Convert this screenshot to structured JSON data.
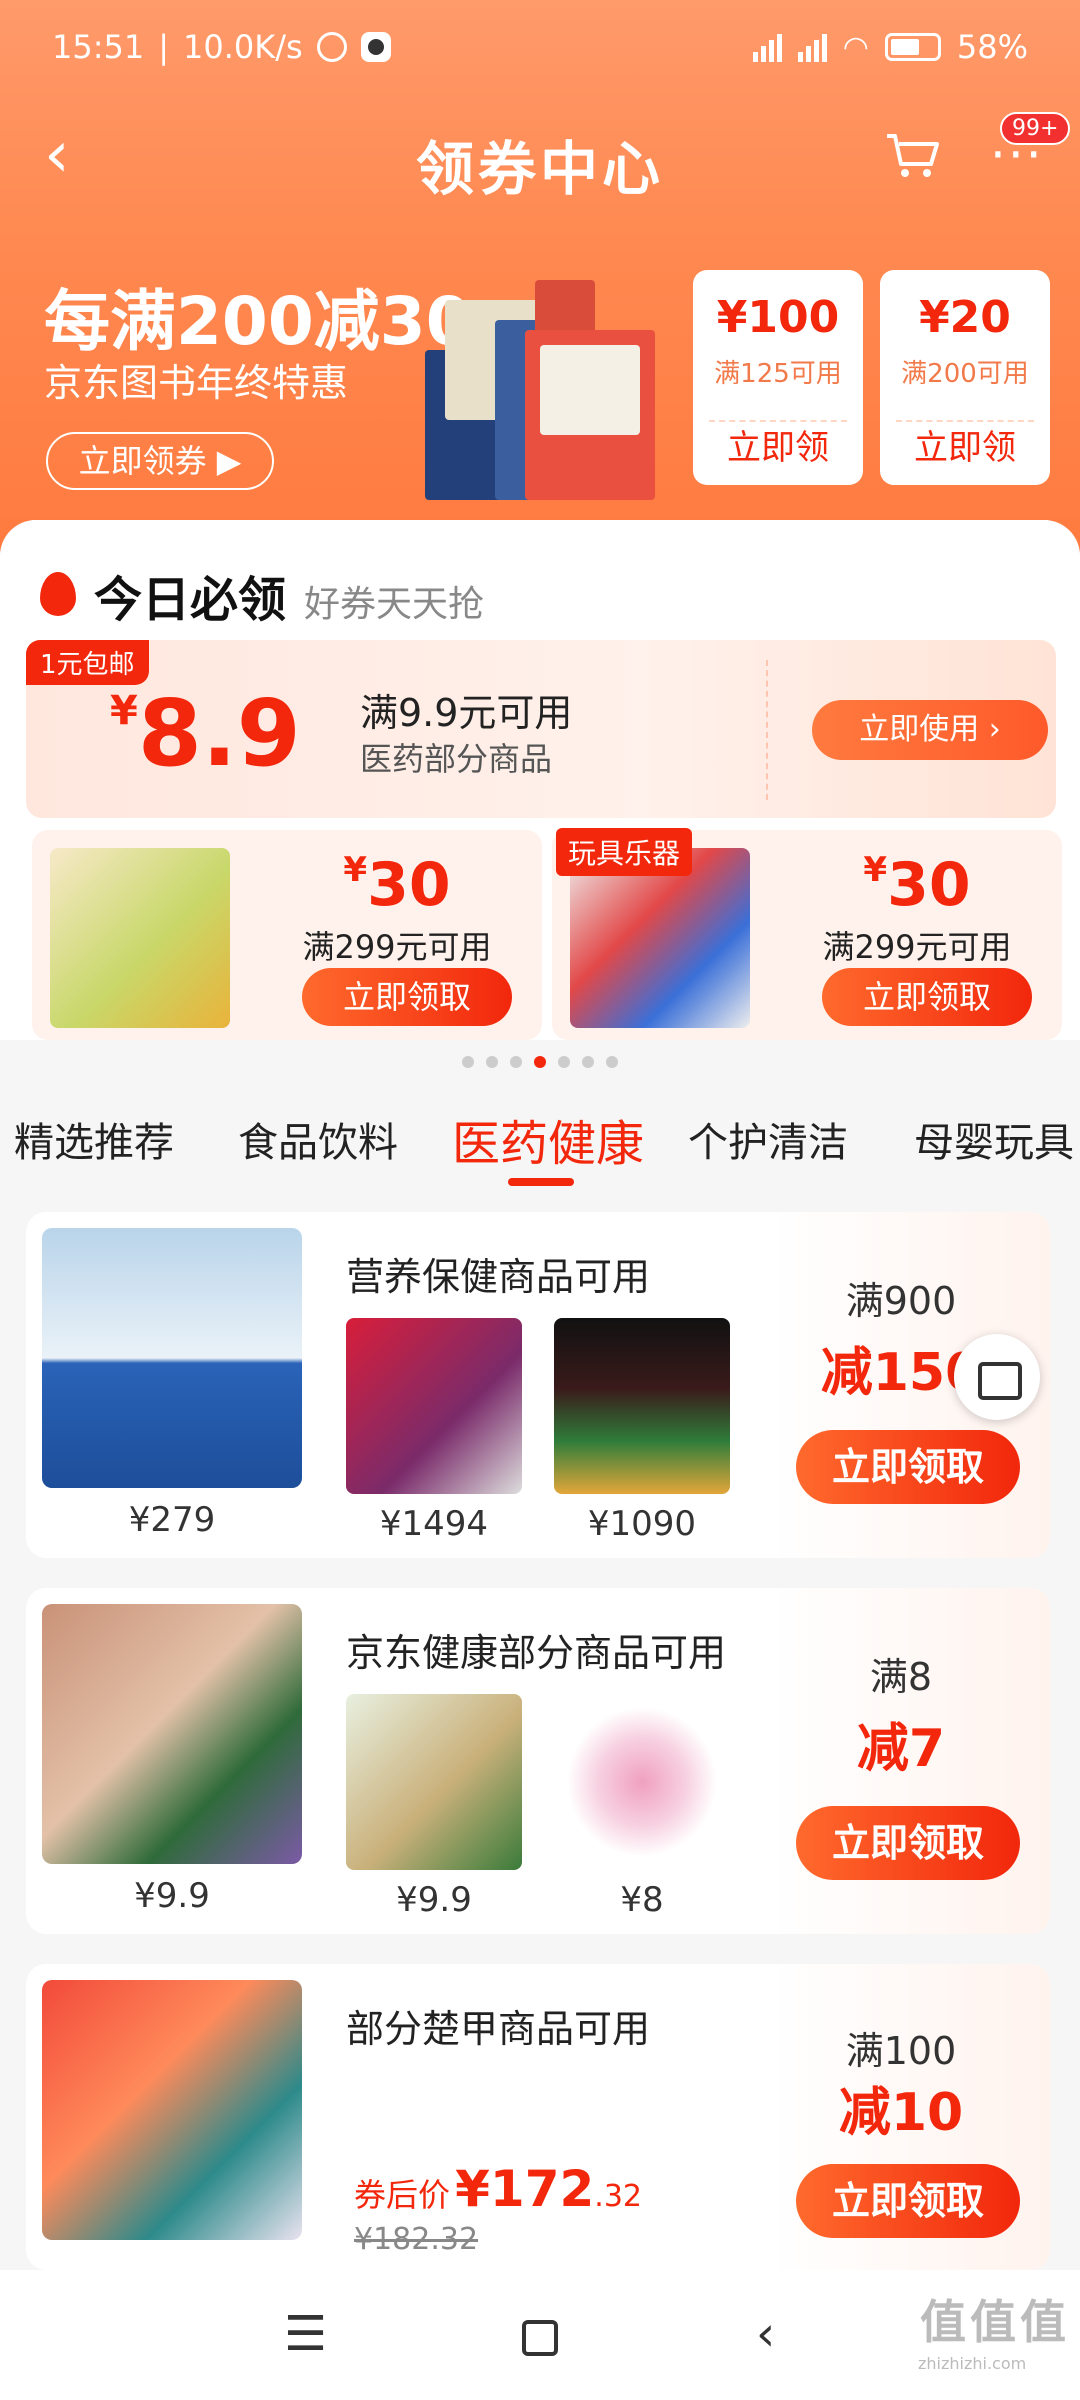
{
  "status": {
    "time": "15:51",
    "speed": "10.0K/s",
    "battery": "58%"
  },
  "nav": {
    "title": "领券中心",
    "back": "‹",
    "more": "···",
    "badge": "99+"
  },
  "banner": {
    "title": "每满200减30",
    "subtitle": "京东图书年终特惠",
    "button": "立即领券 ▶",
    "coupons": [
      {
        "amount": "¥100",
        "condition": "满125可用",
        "button": "立即领"
      },
      {
        "amount": "¥20",
        "condition": "满200可用",
        "button": "立即领"
      }
    ]
  },
  "today": {
    "heading": "今日必领",
    "sub": "好券天天抢"
  },
  "big_coupon": {
    "tag": "1元包邮",
    "currency": "¥",
    "amount": "8.9",
    "line1": "满9.9元可用",
    "line2": "医药部分商品",
    "button": "立即使用 ›"
  },
  "small_coupons": [
    {
      "currency": "¥",
      "amount": "30",
      "condition": "满299元可用",
      "button": "立即领取"
    },
    {
      "currency": "¥",
      "amount": "30",
      "condition": "满299元可用",
      "button": "立即领取",
      "tag": "玩具乐器"
    }
  ],
  "tabs": [
    "精选推荐",
    "食品饮料",
    "医药健康",
    "个护清洁",
    "母婴玩具"
  ],
  "active_tab": "医药健康",
  "cards": [
    {
      "desc": "营养保健商品可用",
      "main_price": "¥279",
      "thumb_prices": [
        "¥1494",
        "¥1090"
      ],
      "man": "满900",
      "jian": "减150",
      "button": "立即领取"
    },
    {
      "desc": "京东健康部分商品可用",
      "main_price": "¥9.9",
      "thumb_prices": [
        "¥9.9",
        "¥8"
      ],
      "man": "满8",
      "jian": "减7",
      "button": "立即领取"
    },
    {
      "desc": "部分楚甲商品可用",
      "after_label": "券后价",
      "after_price": "¥172",
      "after_decimal": ".32",
      "original": "¥182.32",
      "man": "满100",
      "jian": "减10",
      "button": "立即领取"
    }
  ],
  "watermark": {
    "main": "值值值",
    "sub": "zhizhizhi.com"
  },
  "colors": {
    "accent": "#f2270c",
    "header": "#ff8a52"
  }
}
